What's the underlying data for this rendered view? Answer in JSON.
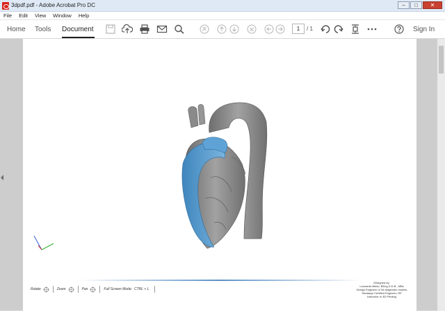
{
  "window": {
    "title": "3dpdf.pdf - Adobe Acrobat Pro DC",
    "minimize": "–",
    "maximize": "□",
    "close": "✕"
  },
  "menu": [
    "File",
    "Edit",
    "View",
    "Window",
    "Help"
  ],
  "toolbar": {
    "tabs": [
      "Home",
      "Tools",
      "Document"
    ],
    "active_tab": "Document",
    "page_current": "1",
    "page_total": "/ 1",
    "sign_in": "Sign In",
    "icons": [
      "save-icon",
      "upload-icon",
      "print-icon",
      "email-icon",
      "search-icon",
      "scroll-top-icon",
      "scroll-up-icon",
      "scroll-down-icon",
      "scroll-bottom-icon",
      "previous-view-icon",
      "next-view-icon",
      "rotate-counterclockwise-icon",
      "rotate-clockwise-icon",
      "page-fit-icon",
      "more-icon",
      "help-icon"
    ]
  },
  "viewer": {
    "model": "heart-3d-model",
    "controls": {
      "rotate": "Rotate",
      "zoom": "Zoom",
      "pan": "Pan",
      "fullscreen": "Full Screen Mode:",
      "fullscreen_key": "CTRL + L"
    },
    "credits": [
      "Designed by:",
      "Leonardo Bledo, BEng D.D.B., MBs",
      "Design Engineer of 3d diagnostic models",
      "Stratasys Certified Engineer, RP",
      "Instructor in 3D Printing"
    ]
  },
  "colors": {
    "accent_blue": "#5aa0d2",
    "model_gray": "#8f8f8f",
    "workspace": "#cdcdcd"
  }
}
